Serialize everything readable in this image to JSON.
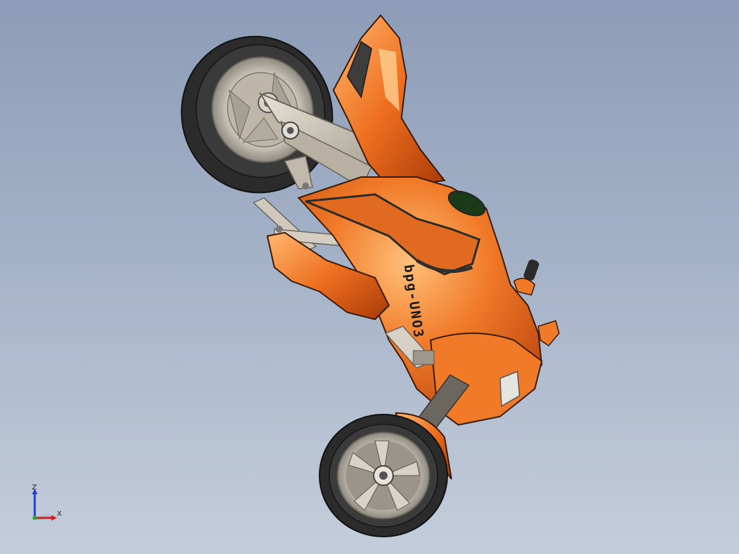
{
  "viewport": {
    "background_top": "#8d9db7",
    "background_bottom": "#c4cddb"
  },
  "model": {
    "decal_text": "bpg-UNO3",
    "body_color": "#e8651a",
    "body_highlight": "#ffb070",
    "frame_color": "#c9c2b2",
    "tire_color": "#2a2a2a"
  },
  "triad": {
    "z_label": "Z",
    "x_label": "X",
    "z_color": "#1f3fd6",
    "x_color": "#d11f1f",
    "y_color": "#2aa52a"
  }
}
